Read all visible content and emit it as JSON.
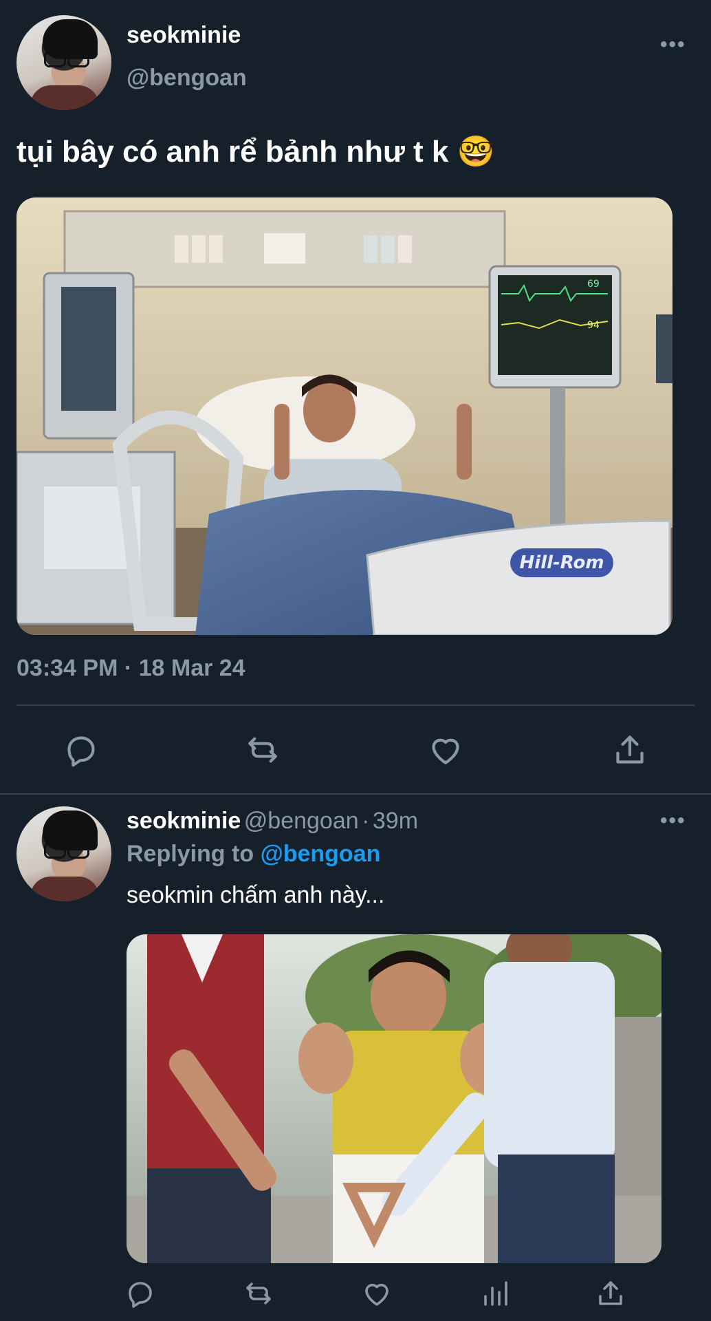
{
  "tweet": {
    "display_name": "seokminie",
    "handle": "@bengoan",
    "text": "tụi bây có anh rể bảnh như t k 🤓",
    "image_caption_brand": "Hill-Rom",
    "monitor_readings": [
      "69",
      "94"
    ],
    "timestamp": "03:34 PM · 18 Mar 24"
  },
  "reply": {
    "display_name": "seokminie",
    "handle": "@bengoan",
    "separator": "·",
    "age": "39m",
    "replying_prefix": "Replying to",
    "replying_handle": "@bengoan",
    "text": "seokmin chấm anh này..."
  },
  "icons": {
    "more": "more-horizontal-icon",
    "reply": "comment-icon",
    "retweet": "retweet-icon",
    "like": "heart-icon",
    "share": "share-icon",
    "views": "analytics-icon"
  },
  "colors": {
    "background": "#15202b",
    "secondary_text": "#8b98a5",
    "link": "#1d9bf0",
    "divider": "#38444d"
  }
}
